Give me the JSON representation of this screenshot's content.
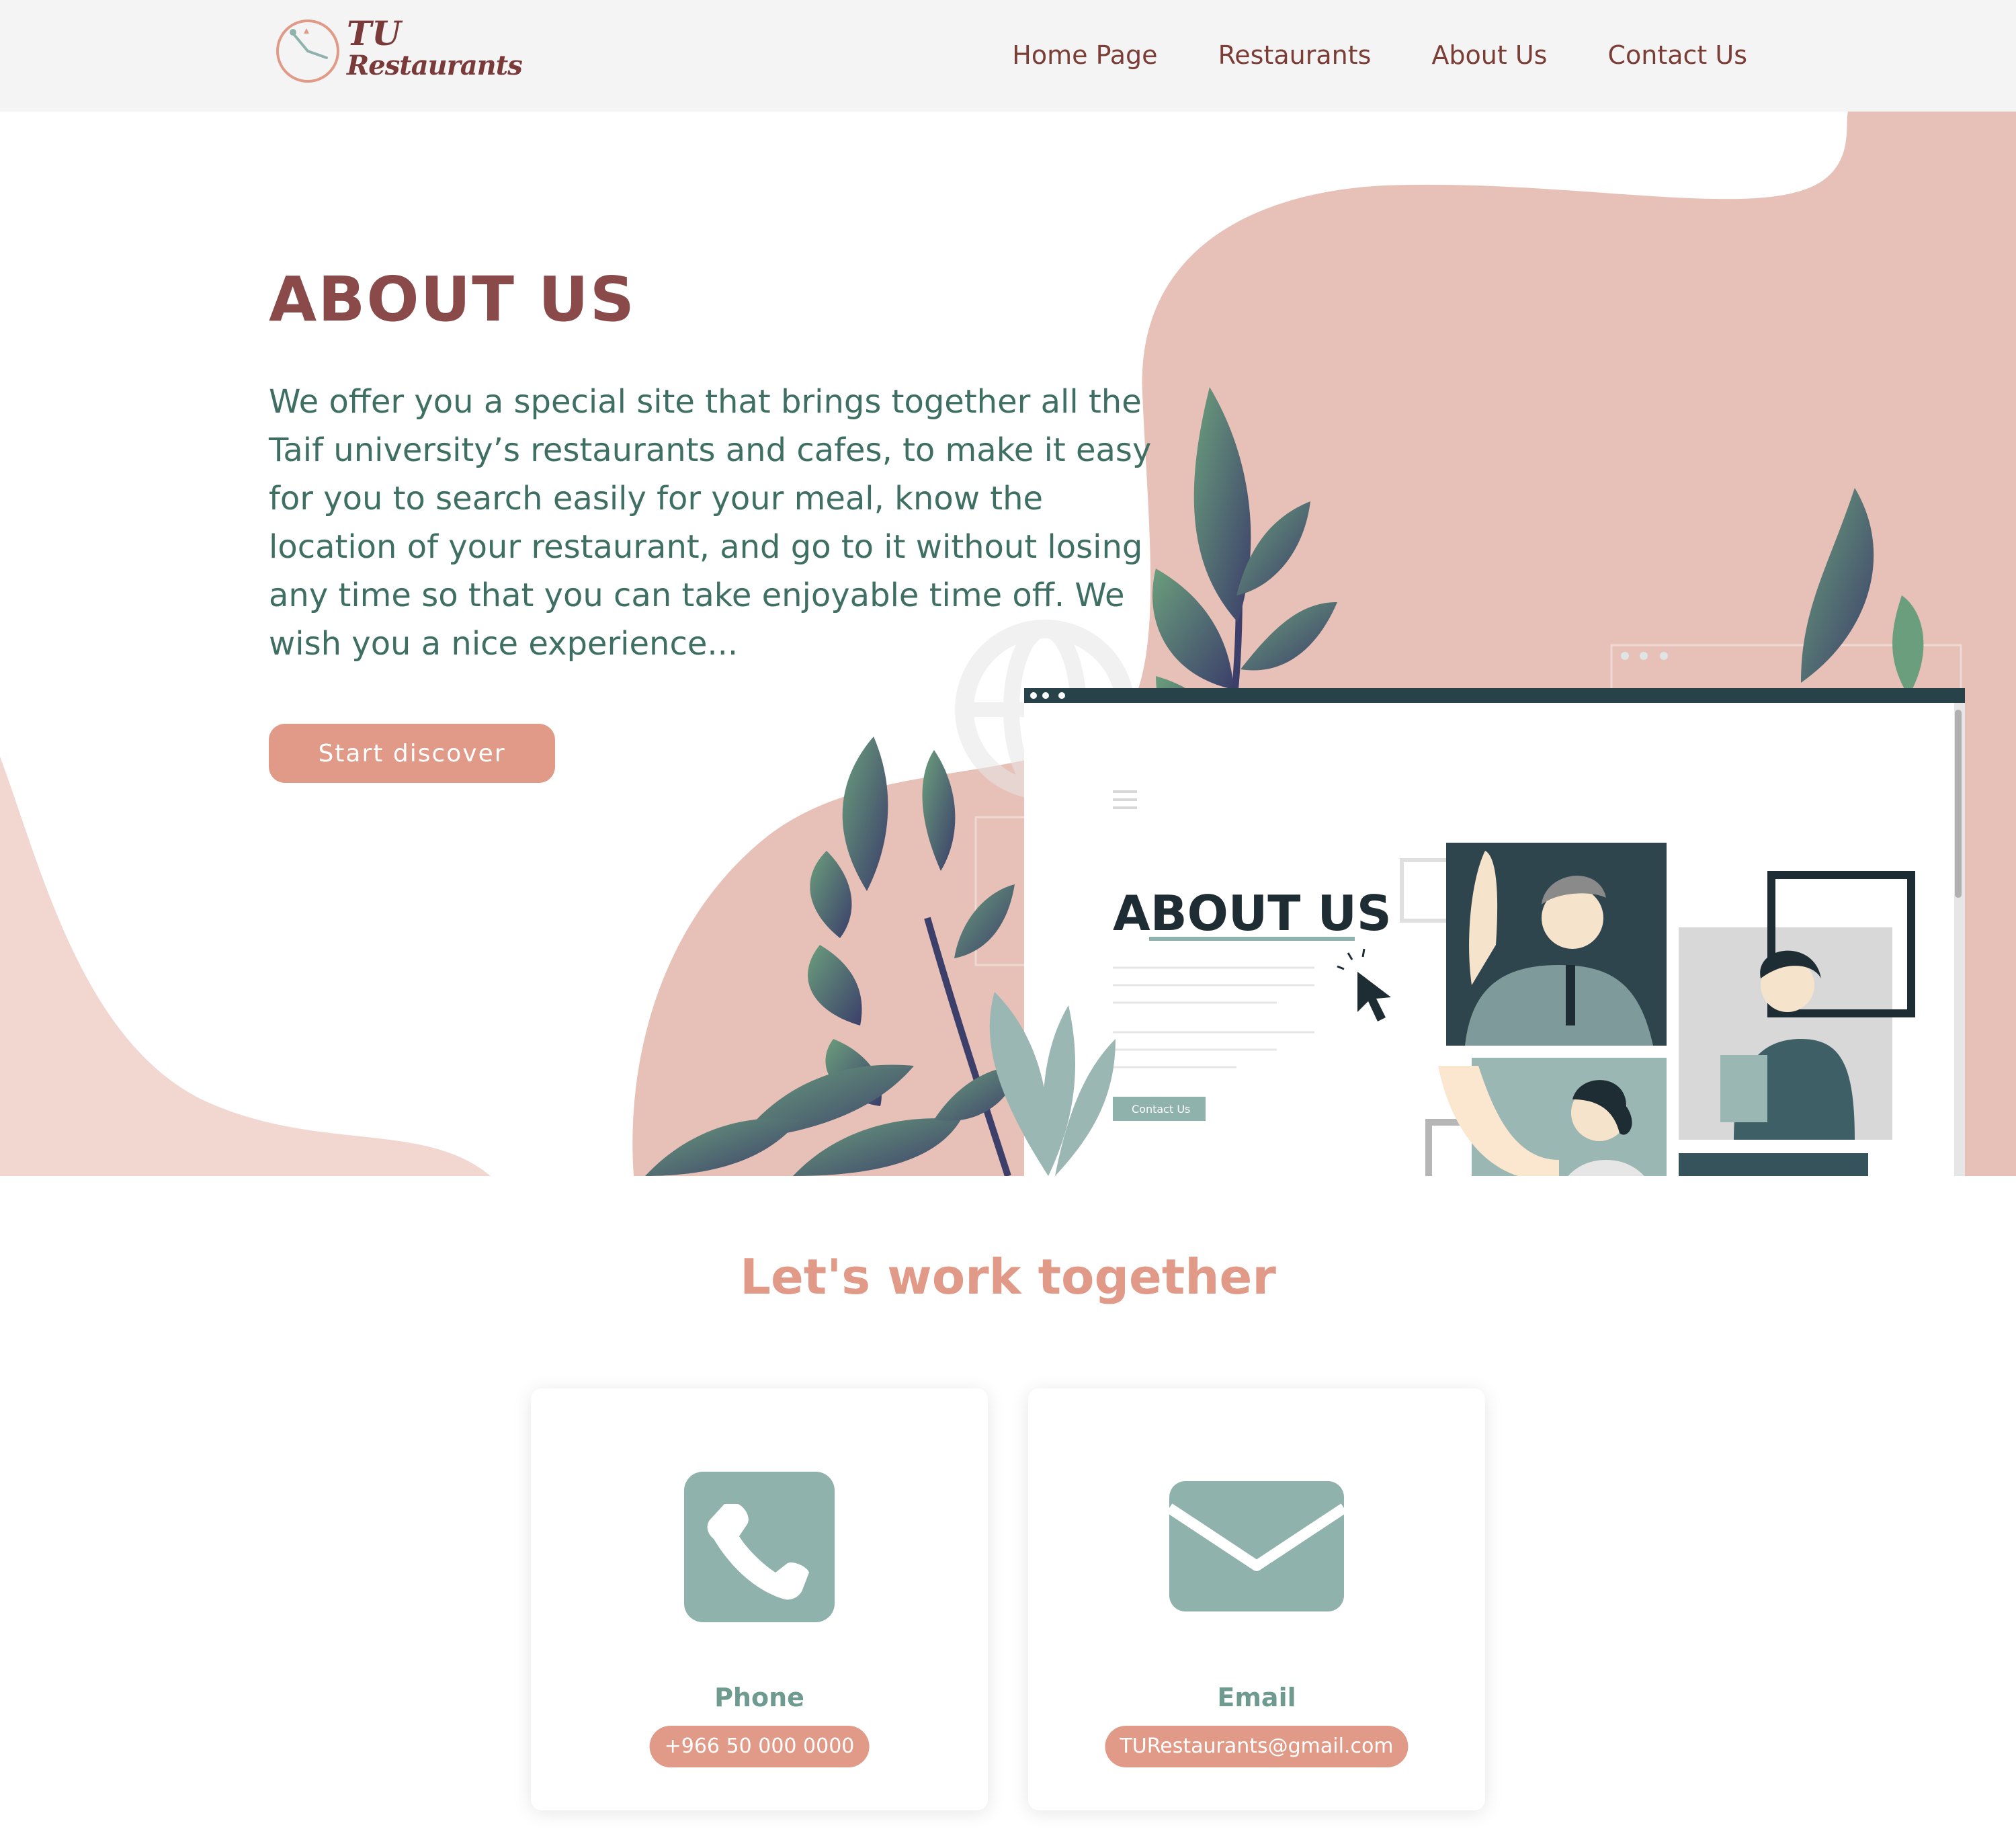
{
  "brand": {
    "line1": "TU",
    "line2": "Restaurants"
  },
  "nav": {
    "items": [
      {
        "label": "Home Page"
      },
      {
        "label": "Restaurants"
      },
      {
        "label": "About Us"
      },
      {
        "label": "Contact Us"
      }
    ]
  },
  "hero": {
    "title": "ABOUT US",
    "lines": [
      "We offer you a special site that brings together all the",
      "Taif university’s restaurants and cafes, to make it easy",
      "for you to search easily for your meal, know the",
      "location of your restaurant, and go to it without losing",
      "any time so that you can take enjoyable time off. We",
      "wish you a nice experience..."
    ],
    "cta_label": "Start discover"
  },
  "illustration": {
    "title": "ABOUT US",
    "button_label": "Contact Us"
  },
  "contact_section": {
    "title": "Let's work together",
    "phone": {
      "label": "Phone",
      "value": "+966 50 000 0000",
      "icon": "phone-icon"
    },
    "email": {
      "label": "Email",
      "value": "TURestaurants@gmail.com",
      "icon": "envelope-icon"
    }
  },
  "colors": {
    "accent": "#e09a87",
    "brand_text": "#7a3e36",
    "heading": "#8a4a4a",
    "body_text": "#3e6f62",
    "icon_teal": "#8fb2ac",
    "blob_pink": "#e7c1b8"
  }
}
